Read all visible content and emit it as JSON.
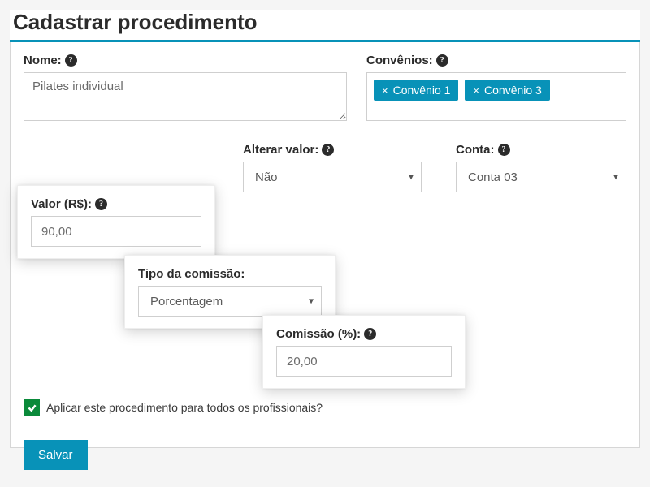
{
  "title": "Cadastrar procedimento",
  "labels": {
    "nome": "Nome:",
    "convenios": "Convênios:",
    "valor": "Valor (R$):",
    "alterar": "Alterar valor:",
    "conta": "Conta:",
    "tipo_comissao": "Tipo da comissão:",
    "comissao": "Comissão (%):",
    "aplicar_todos": "Aplicar este procedimento para todos os profissionais?",
    "salvar": "Salvar"
  },
  "values": {
    "nome": "Pilates individual",
    "valor": "90,00",
    "alterar": "Não",
    "conta": "Conta 03",
    "tipo_comissao": "Porcentagem",
    "comissao": "20,00"
  },
  "convenios": [
    {
      "label": "Convênio 1"
    },
    {
      "label": "Convênio 3"
    }
  ]
}
